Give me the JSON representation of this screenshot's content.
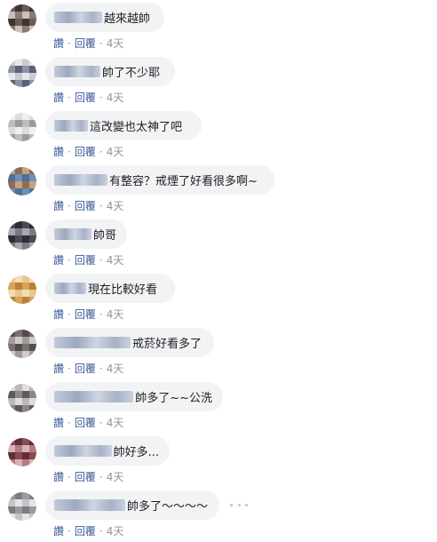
{
  "actions": {
    "like_label": "讚",
    "reply_label": "回覆",
    "separator": "·"
  },
  "comments": [
    {
      "text": "越來越帥",
      "time": "4天",
      "avatar_colors": [
        "#6b5b55",
        "#8a7a70",
        "#3e3431",
        "#c9c0ba"
      ]
    },
    {
      "text": "帥了不少耶",
      "time": "4天",
      "avatar_colors": [
        "#8d93a6",
        "#c9cbd3",
        "#5c6175",
        "#e6e7eb"
      ]
    },
    {
      "text": "這改變也太神了吧",
      "time": "4天",
      "avatar_colors": [
        "#dcdcdc",
        "#bdbdbd",
        "#f0f0f0",
        "#9c9c9c"
      ]
    },
    {
      "text": "有整容？戒煙了好看很多啊~",
      "time": "4天",
      "avatar_colors": [
        "#6f8fb8",
        "#8b6d52",
        "#4f6f9a",
        "#c7a27d"
      ]
    },
    {
      "text": "帥哥",
      "time": "4天",
      "avatar_colors": [
        "#4a4a52",
        "#7a7a86",
        "#2d2d33",
        "#a7a7b0"
      ]
    },
    {
      "text": "現在比較好看",
      "time": "4天",
      "avatar_colors": [
        "#d9a45a",
        "#e9c690",
        "#b98236",
        "#f3dcb6"
      ]
    },
    {
      "text": "戒菸好看多了",
      "time": "4天",
      "avatar_colors": [
        "#7a7272",
        "#a39a9a",
        "#544d4d",
        "#d0caca"
      ]
    },
    {
      "text": "帥多了~~公洗",
      "time": "4天",
      "avatar_colors": [
        "#8f8787",
        "#bdb7b7",
        "#5f5959",
        "#e1dddd"
      ]
    },
    {
      "text": "帥好多...",
      "time": "4天",
      "avatar_colors": [
        "#8a4a52",
        "#b57a80",
        "#5e2e36",
        "#d8b2b6"
      ]
    },
    {
      "text": "帥多了～～～～",
      "time": "4天",
      "avatar_colors": [
        "#c4c4c8",
        "#9a9aa0",
        "#e4e4e6",
        "#7c7c82"
      ]
    }
  ]
}
